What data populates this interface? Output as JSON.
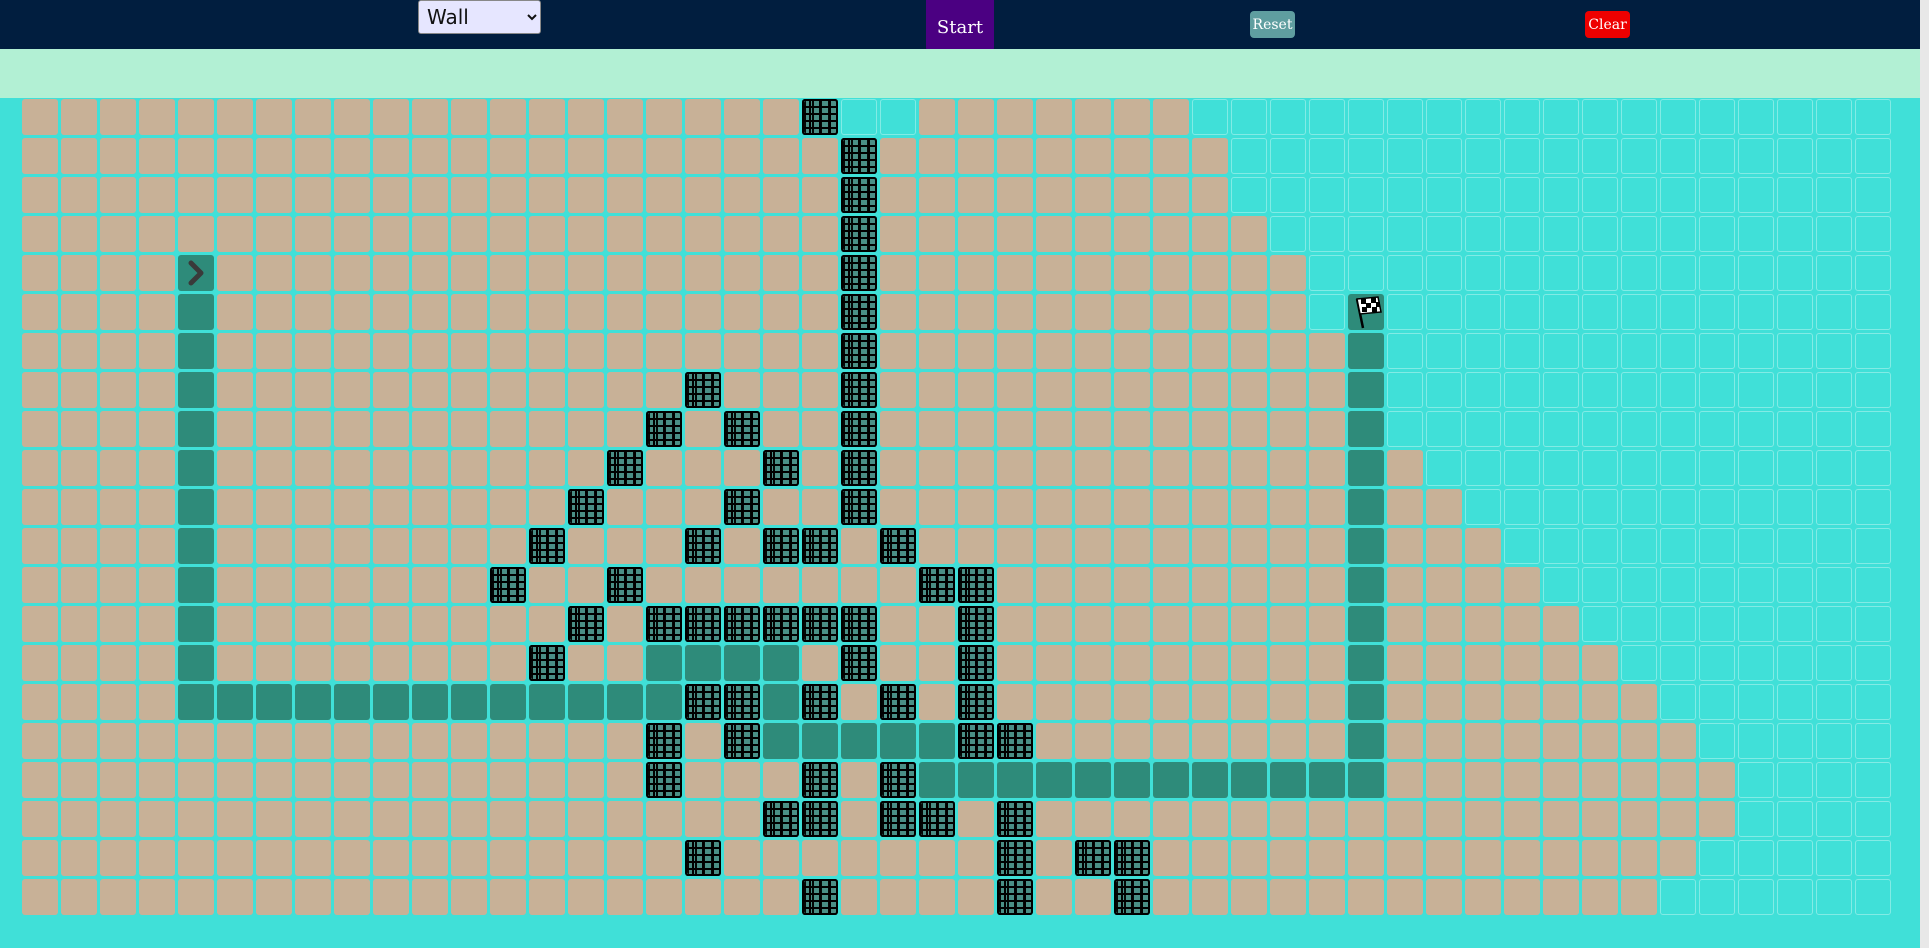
{
  "toolbar": {
    "algorithm_options": [
      "Wall"
    ],
    "algorithm_selected": "Wall",
    "start_label": "Start",
    "reset_label": "Reset",
    "clear_label": "Clear"
  },
  "colors": {
    "topbar": "#011e3f",
    "info_band": "#b2f0d4",
    "unvisited": "#40e0d8",
    "visited": "#c8b197",
    "path": "#2e8b7a",
    "start_button": "#4b0082",
    "reset_button": "#5f9ea0",
    "clear_button": "#ee0000"
  },
  "grid": {
    "rows": 21,
    "cols": 48,
    "start_node": {
      "row": 4,
      "col": 4,
      "icon": "chevron-right-icon"
    },
    "target_node": {
      "row": 5,
      "col": 34,
      "icon": "checkered-flag-icon"
    },
    "walls": [
      [
        0,
        20
      ],
      [
        1,
        21
      ],
      [
        2,
        21
      ],
      [
        3,
        21
      ],
      [
        4,
        21
      ],
      [
        5,
        21
      ],
      [
        6,
        21
      ],
      [
        7,
        17
      ],
      [
        7,
        21
      ],
      [
        8,
        16
      ],
      [
        8,
        18
      ],
      [
        8,
        21
      ],
      [
        9,
        15
      ],
      [
        9,
        19
      ],
      [
        9,
        21
      ],
      [
        10,
        14
      ],
      [
        10,
        18
      ],
      [
        10,
        21
      ],
      [
        11,
        13
      ],
      [
        11,
        17
      ],
      [
        11,
        19
      ],
      [
        11,
        20
      ],
      [
        11,
        22
      ],
      [
        12,
        12
      ],
      [
        12,
        15
      ],
      [
        12,
        23
      ],
      [
        12,
        24
      ],
      [
        13,
        14
      ],
      [
        13,
        16
      ],
      [
        13,
        17
      ],
      [
        13,
        18
      ],
      [
        13,
        19
      ],
      [
        13,
        20
      ],
      [
        13,
        21
      ],
      [
        13,
        24
      ],
      [
        14,
        13
      ],
      [
        14,
        21
      ],
      [
        14,
        24
      ],
      [
        15,
        17
      ],
      [
        15,
        18
      ],
      [
        15,
        20
      ],
      [
        15,
        22
      ],
      [
        15,
        24
      ],
      [
        16,
        16
      ],
      [
        16,
        18
      ],
      [
        16,
        24
      ],
      [
        16,
        25
      ],
      [
        17,
        16
      ],
      [
        17,
        20
      ],
      [
        17,
        22
      ],
      [
        18,
        19
      ],
      [
        18,
        20
      ],
      [
        18,
        22
      ],
      [
        18,
        23
      ],
      [
        18,
        25
      ],
      [
        19,
        17
      ],
      [
        19,
        25
      ],
      [
        19,
        27
      ],
      [
        19,
        28
      ],
      [
        20,
        20
      ],
      [
        20,
        25
      ],
      [
        20,
        28
      ]
    ],
    "path": [
      [
        4,
        4
      ],
      [
        5,
        4
      ],
      [
        6,
        4
      ],
      [
        7,
        4
      ],
      [
        8,
        4
      ],
      [
        9,
        4
      ],
      [
        10,
        4
      ],
      [
        11,
        4
      ],
      [
        12,
        4
      ],
      [
        13,
        4
      ],
      [
        14,
        4
      ],
      [
        15,
        4
      ],
      [
        15,
        5
      ],
      [
        15,
        6
      ],
      [
        15,
        7
      ],
      [
        15,
        8
      ],
      [
        15,
        9
      ],
      [
        15,
        10
      ],
      [
        15,
        11
      ],
      [
        15,
        12
      ],
      [
        15,
        13
      ],
      [
        15,
        14
      ],
      [
        15,
        15
      ],
      [
        15,
        16
      ],
      [
        14,
        16
      ],
      [
        14,
        17
      ],
      [
        14,
        18
      ],
      [
        14,
        19
      ],
      [
        15,
        19
      ],
      [
        16,
        19
      ],
      [
        16,
        20
      ],
      [
        16,
        21
      ],
      [
        16,
        22
      ],
      [
        16,
        23
      ],
      [
        17,
        23
      ],
      [
        17,
        24
      ],
      [
        17,
        25
      ],
      [
        17,
        26
      ],
      [
        17,
        27
      ],
      [
        17,
        28
      ],
      [
        17,
        29
      ],
      [
        17,
        30
      ],
      [
        17,
        31
      ],
      [
        17,
        32
      ],
      [
        17,
        33
      ],
      [
        17,
        34
      ],
      [
        16,
        34
      ],
      [
        15,
        34
      ],
      [
        14,
        34
      ],
      [
        13,
        34
      ],
      [
        12,
        34
      ],
      [
        11,
        34
      ],
      [
        10,
        34
      ],
      [
        9,
        34
      ],
      [
        8,
        34
      ],
      [
        7,
        34
      ],
      [
        6,
        34
      ],
      [
        5,
        34
      ]
    ],
    "visited_extent": [
      29,
      30,
      30,
      31,
      32,
      32,
      33,
      34,
      34,
      35,
      36,
      37,
      38,
      39,
      40,
      41,
      42,
      43,
      43,
      42,
      41
    ],
    "visited_gaps": [
      [
        0,
        21
      ],
      [
        0,
        22
      ]
    ]
  }
}
